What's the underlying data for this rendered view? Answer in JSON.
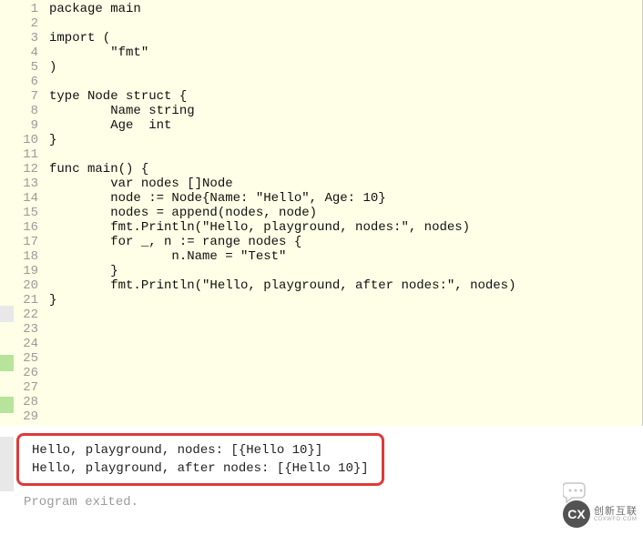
{
  "code": {
    "lines": [
      {
        "n": "1",
        "t": "package main"
      },
      {
        "n": "2",
        "t": ""
      },
      {
        "n": "3",
        "t": "import ("
      },
      {
        "n": "4",
        "t": "        \"fmt\""
      },
      {
        "n": "5",
        "t": ")"
      },
      {
        "n": "6",
        "t": ""
      },
      {
        "n": "7",
        "t": "type Node struct {"
      },
      {
        "n": "8",
        "t": "        Name string"
      },
      {
        "n": "9",
        "t": "        Age  int"
      },
      {
        "n": "10",
        "t": "}"
      },
      {
        "n": "11",
        "t": ""
      },
      {
        "n": "12",
        "t": "func main() {"
      },
      {
        "n": "13",
        "t": "        var nodes []Node"
      },
      {
        "n": "14",
        "t": "        node := Node{Name: \"Hello\", Age: 10}"
      },
      {
        "n": "15",
        "t": "        nodes = append(nodes, node)"
      },
      {
        "n": "16",
        "t": "        fmt.Println(\"Hello, playground, nodes:\", nodes)"
      },
      {
        "n": "17",
        "t": "        for _, n := range nodes {"
      },
      {
        "n": "18",
        "t": "                n.Name = \"Test\""
      },
      {
        "n": "19",
        "t": "        }"
      },
      {
        "n": "20",
        "t": "        fmt.Println(\"Hello, playground, after nodes:\", nodes)"
      },
      {
        "n": "21",
        "t": "}"
      },
      {
        "n": "22",
        "t": ""
      },
      {
        "n": "23",
        "t": ""
      },
      {
        "n": "24",
        "t": ""
      },
      {
        "n": "25",
        "t": ""
      },
      {
        "n": "26",
        "t": ""
      },
      {
        "n": "27",
        "t": ""
      },
      {
        "n": "28",
        "t": ""
      },
      {
        "n": "29",
        "t": ""
      }
    ]
  },
  "output": {
    "highlighted": [
      "Hello, playground, nodes: [{Hello 10}]",
      "Hello, playground, after nodes: [{Hello 10}]"
    ],
    "exit": "Program exited."
  },
  "watermark": {
    "logo": "CX",
    "title": "创新互联",
    "sub": "CDXWFO.COM"
  }
}
